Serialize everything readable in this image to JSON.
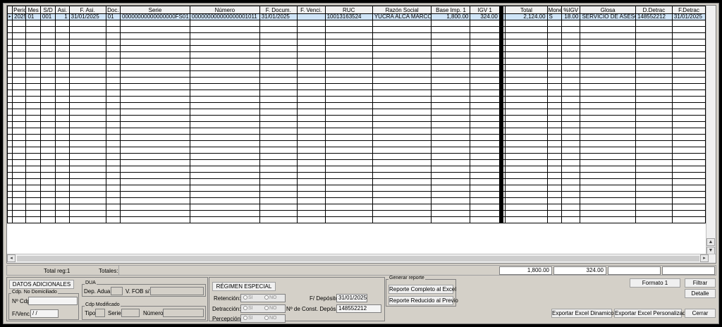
{
  "grid": {
    "columns": [
      "Perio",
      "Mes",
      "S/D",
      "Asi.",
      "F. Asi.",
      "Doc.",
      "Serie",
      "Número",
      "F. Docum.",
      "F. Venci.",
      "RUC",
      "Razón Social",
      "Base Imp. 1",
      "IGV 1",
      "",
      "Total",
      "Mone",
      "%IGV",
      "Glosa",
      "D.Detrac",
      "F.Detrac"
    ],
    "rows": [
      [
        "2025",
        "01",
        "001",
        "1",
        "31/01/2025",
        "01",
        "00000000000000000FS01",
        "000000000000000001011",
        "31/01/2025",
        "",
        "10013163524",
        "YUCRA ALCA MARCO",
        "1,800.00",
        "324.00",
        "",
        "2,124.00",
        "S",
        "18.00",
        "SERVICIO DE ASESO",
        "148552212",
        "31/01/2025"
      ]
    ],
    "row_indicator": "▸",
    "scroll_up": "▲",
    "scroll_down": "▼",
    "scroll_left": "◂",
    "scroll_right": "▸"
  },
  "totals": {
    "count_label": "Total reg:1",
    "totals_label": "Totales:",
    "base": "1,800.00",
    "igv": "324.00"
  },
  "adicionales": {
    "button": "DATOS ADICIONALES",
    "no_dom_title": "Cdp. No Domiciliado",
    "ncdp_label": "Nº Cdp",
    "fvenc_label": "F/Venc.",
    "fvenc_value": " /  /"
  },
  "dua": {
    "title": "DUA",
    "dep_label": "Dep. Adua.",
    "fob_label": "V. FOB s/.:"
  },
  "cdp_mod": {
    "title": "Cdp Modificado",
    "tipo_label": "Tipo",
    "serie_label": "Serie",
    "numero_label": "Número"
  },
  "regimen": {
    "button": "RÉGIMEN ESPECIAL",
    "retencion": "Retención:",
    "detraccion": "Detracción:",
    "percepcion": "Percepción:",
    "si": "SI",
    "no": "NO",
    "fdeposito_label": "F/ Depósito:",
    "fdeposito_value": "31/01/2025",
    "const_label": "Nº de Const. Depósito:",
    "const_value": "148552212"
  },
  "reporte": {
    "title": "Generar reporte",
    "completo": "Reporte Completo al Excel",
    "reducido": "Reporte Reducido al Previo"
  },
  "actions": {
    "formato": "Formato 1",
    "filtrar": "Filtrar",
    "detalle": "Detalle",
    "excel_dinamico": "Exportar Excel Dinamico",
    "excel_personalizado": "Exportar Excel Personalizado",
    "cerrar": "Cerrar"
  }
}
